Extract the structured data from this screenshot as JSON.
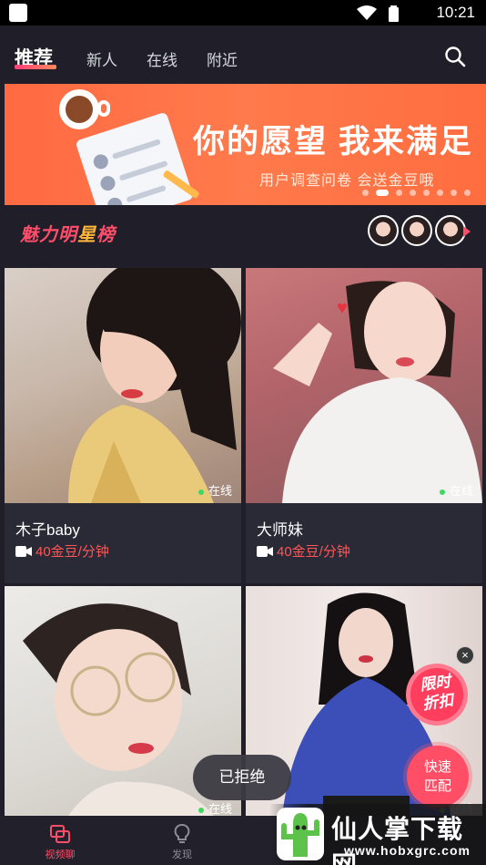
{
  "status_bar": {
    "time": "10:21"
  },
  "top_nav": {
    "tabs": [
      {
        "label": "推荐",
        "active": true
      },
      {
        "label": "新人",
        "active": false
      },
      {
        "label": "在线",
        "active": false
      },
      {
        "label": "附近",
        "active": false
      }
    ],
    "search_icon": "search-icon"
  },
  "banner": {
    "title": "你的愿望  我来满足",
    "subtitle": "用户调查问卷   会送金豆哦",
    "page_count": 8,
    "active_page": 1
  },
  "charm_rank": {
    "title_a": "魅力明",
    "title_b": "星",
    "title_c": "榜",
    "avatar_count": 3
  },
  "cards": [
    {
      "name": "木子baby",
      "price": "40金豆/分钟",
      "status": "在线"
    },
    {
      "name": "大师妹",
      "price": "40金豆/分钟",
      "status": "在线"
    },
    {
      "name": "",
      "price": "",
      "status": "在线"
    },
    {
      "name": "",
      "price": "",
      "status": "在线"
    }
  ],
  "toast": "已拒绝",
  "promo": {
    "badge": "限时\n折扣",
    "badge_line1": "限时",
    "badge_line2": "折扣",
    "match_line1": "快速",
    "match_line2": "匹配",
    "close": "×"
  },
  "bottom_nav": [
    {
      "label": "视频聊",
      "icon": "video-chat-icon",
      "active": true
    },
    {
      "label": "发现",
      "icon": "lightbulb-icon",
      "active": false
    }
  ],
  "watermark": {
    "text": "仙人掌下载网",
    "url": "www.hobxgrc.com"
  },
  "colors": {
    "accent": "#ff4d6a",
    "online": "#3ed860",
    "banner": "#ff6a42",
    "background": "#1f1e29"
  }
}
